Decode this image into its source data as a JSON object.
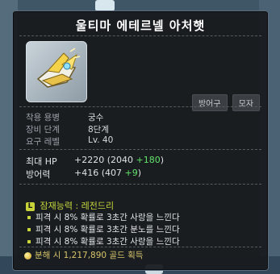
{
  "item": {
    "name": "울티마 에테르넬 아처햇",
    "icon": "archer-hat-icon",
    "tags": [
      "방어구",
      "모자"
    ]
  },
  "info": [
    {
      "label": "착용 용병",
      "value": "궁수"
    },
    {
      "label": "장비 단계",
      "value": "8단계"
    },
    {
      "label": "요구 레벨",
      "value": "Lv. 40"
    }
  ],
  "stats": [
    {
      "label": "최대 HP",
      "value": "+2220",
      "base_open": "(2040 ",
      "bonus": "+180",
      "close": ")"
    },
    {
      "label": "방어력",
      "value": "+416",
      "base_open": "(407 ",
      "bonus": "+9",
      "close": ")"
    }
  ],
  "potential": {
    "badge": "L",
    "label": "잠재능력 : 레전드리",
    "lines": [
      "피격 시 8% 확률로 3초간 사랑을 느낀다",
      "피격 시 8% 확률로 3초간 분노를 느낀다",
      "피격 시 8% 확률로 3초간 사랑을 느낀다"
    ]
  },
  "disassemble": "분해 시 1,217,890 골드 획득",
  "colors": {
    "bonus": "#62e36a",
    "legendary": "#c6d63b",
    "gold": "#d7c46a"
  }
}
